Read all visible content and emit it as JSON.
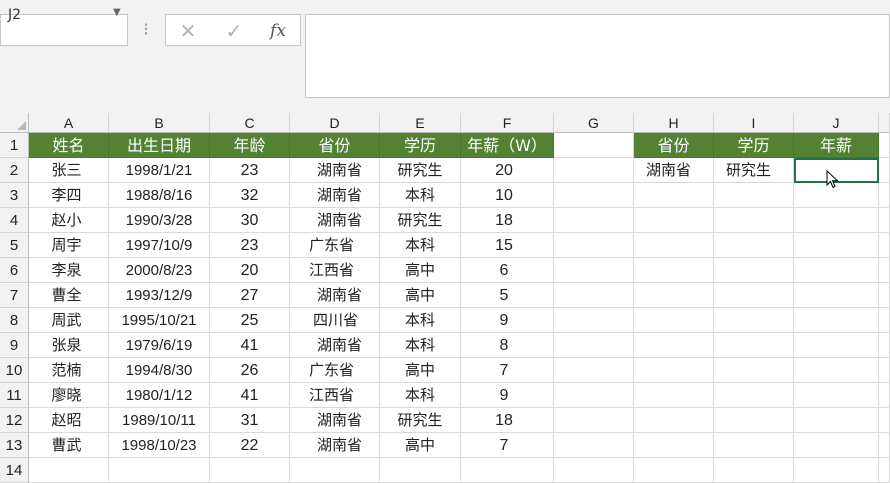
{
  "formula_bar": {
    "name_box": "J2",
    "cancel_icon": "✕",
    "enter_icon": "✓",
    "fx_label": "fx",
    "formula": ""
  },
  "columns": [
    "A",
    "B",
    "C",
    "D",
    "E",
    "F",
    "G",
    "H",
    "I",
    "J"
  ],
  "rows": [
    "1",
    "2",
    "3",
    "4",
    "5",
    "6",
    "7",
    "8",
    "9",
    "10",
    "11",
    "12",
    "13",
    "14"
  ],
  "table": {
    "headers": [
      "姓名",
      "出生日期",
      "年龄",
      "省份",
      "学历",
      "年薪（W）"
    ],
    "records": [
      [
        "张三",
        "1998/1/21",
        "23",
        "湖南省",
        "研究生",
        "20"
      ],
      [
        "李四",
        "1988/8/16",
        "32",
        "湖南省",
        "本科",
        "10"
      ],
      [
        "赵小",
        "1990/3/28",
        "30",
        "湖南省",
        "研究生",
        "18"
      ],
      [
        "周宇",
        "1997/10/9",
        "23",
        "广东省",
        "本科",
        "15"
      ],
      [
        "李泉",
        "2000/8/23",
        "20",
        "江西省",
        "高中",
        "6"
      ],
      [
        "曹全",
        "1993/12/9",
        "27",
        "湖南省",
        "高中",
        "5"
      ],
      [
        "周武",
        "1995/10/21",
        "25",
        "四川省",
        "本科",
        "9"
      ],
      [
        "张泉",
        "1979/6/19",
        "41",
        "湖南省",
        "本科",
        "8"
      ],
      [
        "范楠",
        "1994/8/30",
        "26",
        "广东省",
        "高中",
        "7"
      ],
      [
        "廖晓",
        "1980/1/12",
        "41",
        "江西省",
        "本科",
        "9"
      ],
      [
        "赵昭",
        "1989/10/11",
        "31",
        "湖南省",
        "研究生",
        "18"
      ],
      [
        "曹武",
        "1998/10/23",
        "22",
        "湖南省",
        "高中",
        "7"
      ]
    ]
  },
  "criteria": {
    "headers": [
      "省份",
      "学历",
      "年薪"
    ],
    "values": [
      "湖南省",
      "研究生",
      ""
    ]
  },
  "colors": {
    "header_fill": "#548235",
    "header_text": "#ffffff",
    "selection": "#217346"
  }
}
